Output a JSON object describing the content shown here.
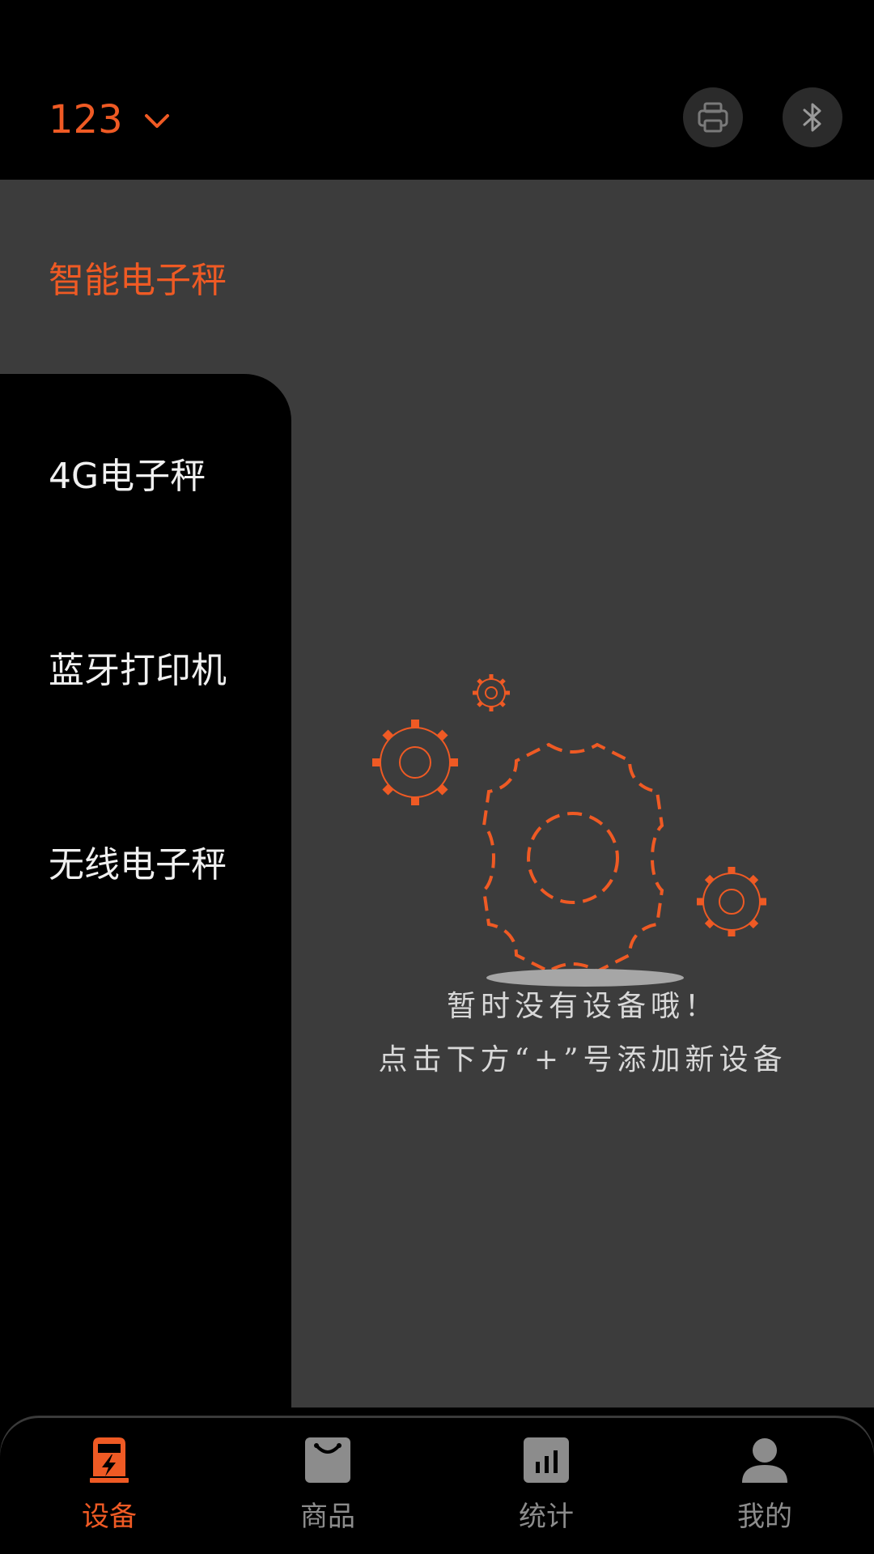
{
  "header": {
    "store_name": "123",
    "printer_icon": "printer-icon",
    "bluetooth_icon": "bluetooth-icon"
  },
  "sidebar": {
    "active_category": "智能电子秤",
    "items": [
      {
        "label": "4G电子秤"
      },
      {
        "label": "蓝牙打印机"
      },
      {
        "label": "无线电子秤"
      }
    ],
    "add_icon": "plus-icon"
  },
  "empty_state": {
    "line1": "暂时没有设备哦！",
    "line2": "点击下方“+”号添加新设备",
    "illustration_icon": "gears-icon"
  },
  "bottom_nav": {
    "items": [
      {
        "label": "设备",
        "icon": "device-icon",
        "active": true
      },
      {
        "label": "商品",
        "icon": "bag-icon",
        "active": false
      },
      {
        "label": "统计",
        "icon": "chart-icon",
        "active": false
      },
      {
        "label": "我的",
        "icon": "user-icon",
        "active": false
      }
    ]
  },
  "colors": {
    "accent": "#EF5A24",
    "panel": "#3C3C3C",
    "background": "#000000",
    "inactive": "#8C8C8C"
  }
}
